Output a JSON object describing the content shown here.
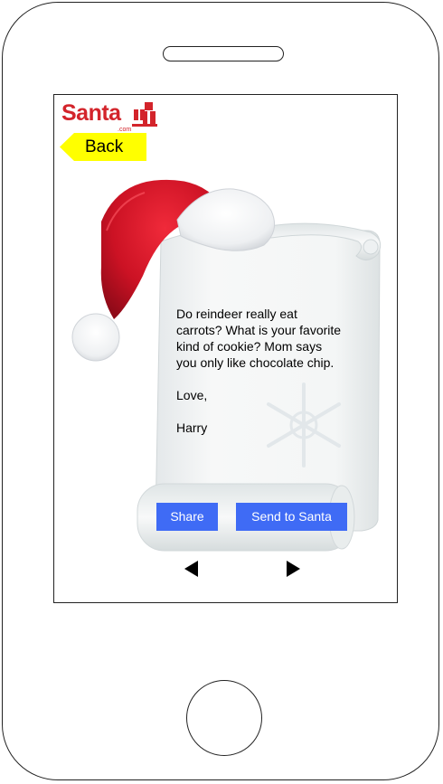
{
  "logo": {
    "text": "Santa",
    "suffix": ".com"
  },
  "nav": {
    "back_label": "Back"
  },
  "letter": {
    "body": "Do reindeer really eat carrots? What is your favorite kind of cookie? Mom says you only like chocolate chip.",
    "closing": "Love,",
    "signature": "Harry"
  },
  "actions": {
    "share_label": "Share",
    "send_label": "Send to Santa"
  },
  "icons": {
    "prev": "triangle-left-icon",
    "next": "triangle-right-icon",
    "gift": "gift-icon",
    "hat": "santa-hat-icon",
    "scroll": "scroll-icon",
    "snowflake": "snowflake-icon"
  },
  "colors": {
    "brand_red": "#d3242b",
    "back_yellow": "#ffff00",
    "button_blue": "#3f6bf5"
  }
}
